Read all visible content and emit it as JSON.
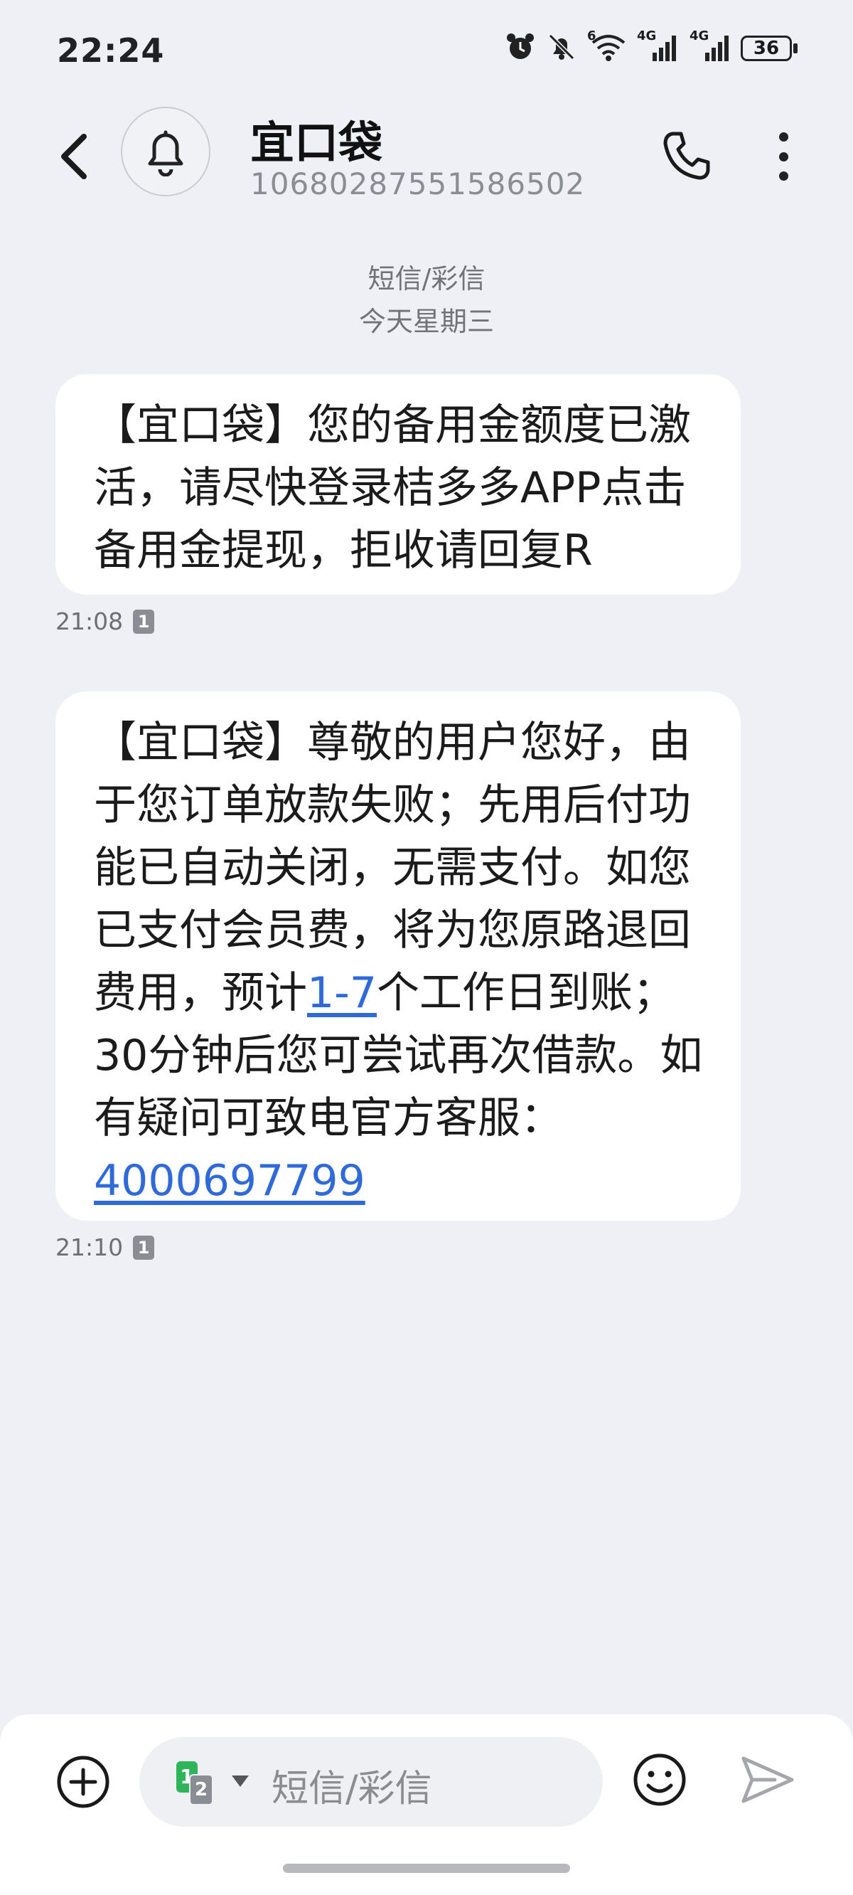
{
  "status_bar": {
    "time": "22:24",
    "signal_1_label": "4G",
    "signal_2_label": "4G",
    "wifi_label": "6",
    "battery": "36"
  },
  "header": {
    "contact_name": "宜口袋",
    "contact_number": "10680287551586502"
  },
  "conversation": {
    "type_label": "短信/彩信",
    "date_label": "今天星期三"
  },
  "messages": [
    {
      "text": "【宜口袋】您的备用金额度已激活，请尽快登录桔多多APP点击备用金提现，拒收请回复R",
      "time": "21:08",
      "sim": "1"
    },
    {
      "text_before_link": "【宜口袋】尊敬的用户您好，由于您订单放款失败；先用后付功能已自动关闭，无需支付。如您已支付会员费，将为您原路退回费用，预计",
      "link_1": "1-7",
      "text_after_link": "个工作日到账；30分钟后您可尝试再次借款。如有疑问可致电官方客服：",
      "link_2": "4000697799",
      "time": "21:10",
      "sim": "1"
    }
  ],
  "composer": {
    "placeholder": "短信/彩信",
    "sim_primary": "1",
    "sim_secondary": "2"
  },
  "colors": {
    "background": "#eef0f6",
    "link": "#2f6ad8",
    "sim_green": "#2fb45a"
  }
}
